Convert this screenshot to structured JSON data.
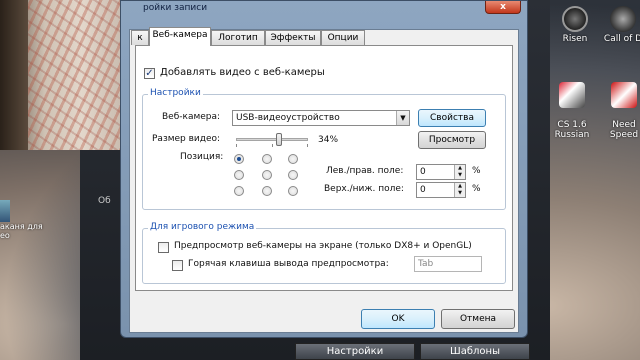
{
  "window": {
    "title": "ройки записи",
    "close_label": "x",
    "tabs": [
      "к",
      "Веб-камера",
      "Логотип",
      "Эффекты",
      "Опции"
    ],
    "active_tab": "Веб-камера"
  },
  "webcam_tab": {
    "add_video_checkbox": {
      "label": "Добавлять видео с веб-камеры",
      "checked": true
    },
    "settings_group": {
      "title": "Настройки",
      "webcam_label": "Веб-камера:",
      "webcam_value": "USB-видеоустройство",
      "properties_button": "Свойства",
      "video_size_label": "Размер видео:",
      "video_size_value": "34%",
      "video_size_fraction": 0.34,
      "preview_button": "Просмотр",
      "position_label": "Позиция:",
      "position_selected": [
        0,
        0
      ],
      "lr_margin_label": "Лев./прав. поле:",
      "lr_margin_value": "0",
      "tb_margin_label": "Верх./ниж. поле:",
      "tb_margin_value": "0",
      "percent": "%"
    },
    "game_group": {
      "title": "Для игрового режима",
      "preview_checkbox": {
        "label": "Предпросмотр веб-камеры на экране (только DX8+ и OpenGL)",
        "checked": false
      },
      "hotkey_checkbox": {
        "label": "Горячая клавиша вывода предпросмотра:",
        "checked": false
      },
      "hotkey_value": "Tab"
    }
  },
  "dialog_buttons": {
    "ok": "OK",
    "cancel": "Отмена"
  },
  "background_app": {
    "side_label": "Об",
    "bottom_buttons": [
      "Настройки",
      "Шаблоны"
    ]
  },
  "desktop": {
    "icons": [
      {
        "label": "Risen",
        "icon": "risen-game-icon"
      },
      {
        "label": "Call of D",
        "icon": "call-of-duty-icon"
      },
      {
        "label": "CS 1.6\nRussian",
        "icon": "counter-strike-icon"
      },
      {
        "label": "Need\nSpeed",
        "icon": "need-for-speed-icon"
      }
    ],
    "left_labels": [
      "аканя для",
      "ео"
    ]
  }
}
